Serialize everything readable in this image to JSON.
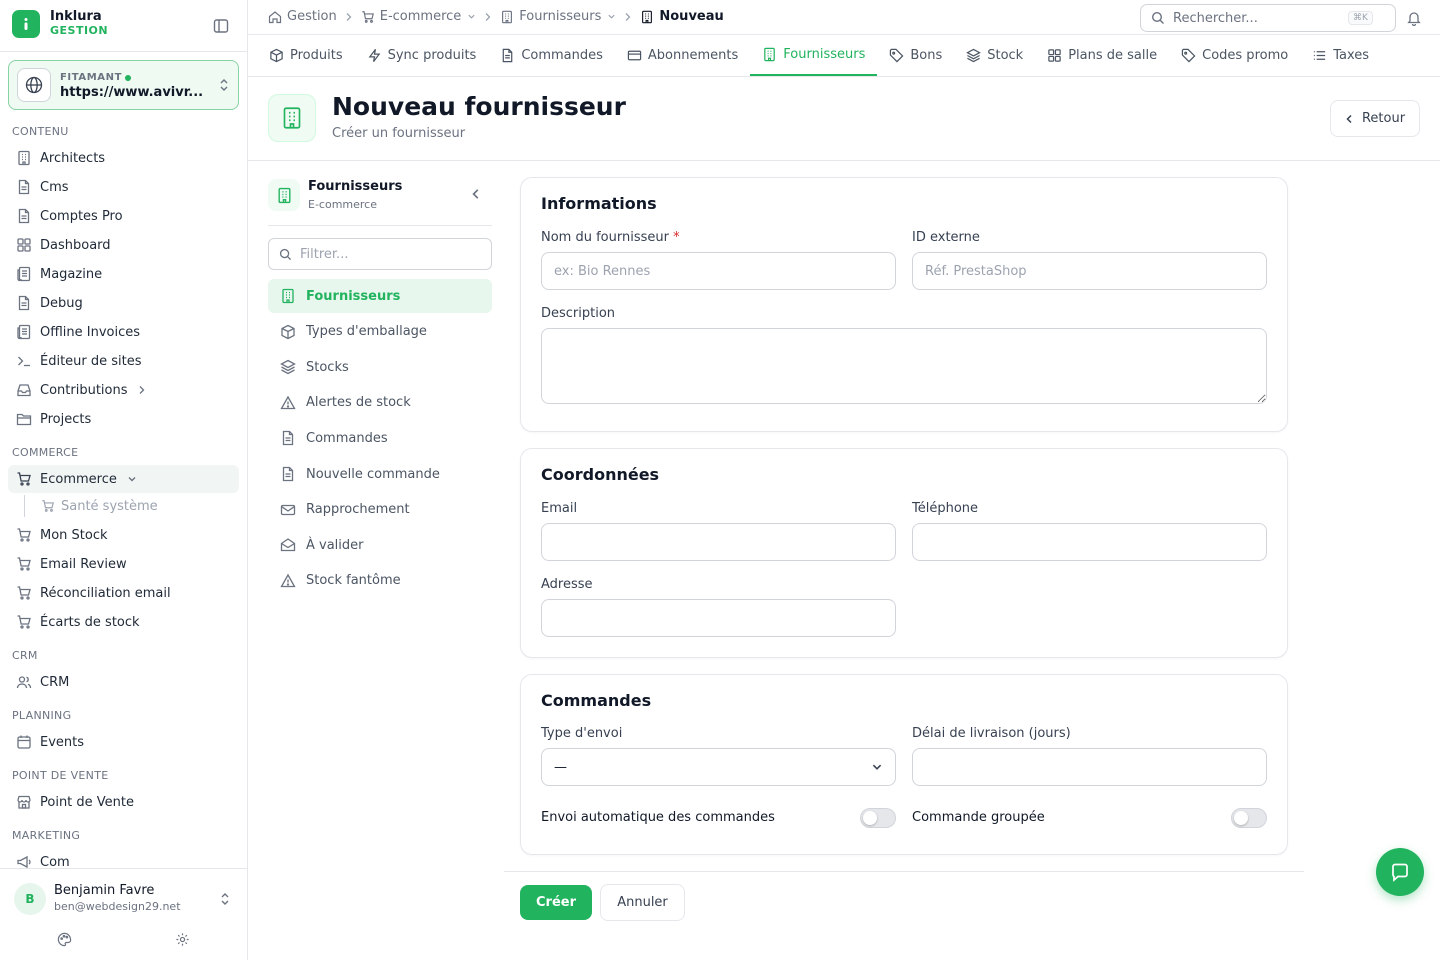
{
  "brand": {
    "name": "Inklura",
    "sub": "GESTION"
  },
  "site": {
    "label": "FITAMANT",
    "url": "https://www.avivr..."
  },
  "sidebar": {
    "sections": {
      "contenu": "CONTENU",
      "commerce": "COMMERCE",
      "crm": "CRM",
      "planning": "PLANNING",
      "pos": "POINT DE VENTE",
      "marketing": "MARKETING"
    },
    "contenu_items": [
      {
        "label": "Architects",
        "icon": "building-icon"
      },
      {
        "label": "Cms",
        "icon": "file-icon"
      },
      {
        "label": "Comptes Pro",
        "icon": "file-icon"
      },
      {
        "label": "Dashboard",
        "icon": "grid-icon"
      },
      {
        "label": "Magazine",
        "icon": "newspaper-icon"
      },
      {
        "label": "Debug",
        "icon": "file-icon"
      },
      {
        "label": "Offline Invoices",
        "icon": "newspaper-icon"
      },
      {
        "label": "Éditeur de sites",
        "icon": "terminal-icon"
      },
      {
        "label": "Contributions",
        "icon": "inbox-icon"
      },
      {
        "label": "Projects",
        "icon": "folder-icon"
      }
    ],
    "commerce_items": [
      {
        "label": "Ecommerce",
        "icon": "cart-icon"
      },
      {
        "label": "Santé système",
        "icon": "cart-icon"
      },
      {
        "label": "Mon Stock",
        "icon": "cart-icon"
      },
      {
        "label": "Email Review",
        "icon": "cart-icon"
      },
      {
        "label": "Réconciliation email",
        "icon": "cart-icon"
      },
      {
        "label": "Écarts de stock",
        "icon": "cart-icon"
      }
    ],
    "crm_item": "CRM",
    "planning_item": "Events",
    "pos_item": "Point de Vente",
    "marketing_item": "Com"
  },
  "user": {
    "initial": "B",
    "name": "Benjamin Favre",
    "email": "ben@webdesign29.net"
  },
  "breadcrumb": {
    "home": "Gestion",
    "ecommerce": "E-commerce",
    "fournisseurs": "Fournisseurs",
    "current": "Nouveau"
  },
  "search": {
    "placeholder": "Rechercher...",
    "shortcut": "⌘K"
  },
  "tabs": [
    {
      "label": "Produits",
      "icon": "box-icon"
    },
    {
      "label": "Sync produits",
      "icon": "bolt-icon"
    },
    {
      "label": "Commandes",
      "icon": "file-icon"
    },
    {
      "label": "Abonnements",
      "icon": "card-icon"
    },
    {
      "label": "Fournisseurs",
      "icon": "building-icon",
      "active": true
    },
    {
      "label": "Bons",
      "icon": "tag-icon"
    },
    {
      "label": "Stock",
      "icon": "layers-icon"
    },
    {
      "label": "Plans de salle",
      "icon": "grid-icon"
    },
    {
      "label": "Codes promo",
      "icon": "tag-icon"
    },
    {
      "label": "Taxes",
      "icon": "list-icon"
    }
  ],
  "page": {
    "title": "Nouveau fournisseur",
    "subtitle": "Créer un fournisseur",
    "back_label": "Retour"
  },
  "subnav": {
    "title": "Fournisseurs",
    "subtitle": "E-commerce",
    "filter_placeholder": "Filtrer...",
    "items": [
      {
        "label": "Fournisseurs",
        "icon": "building-icon",
        "active": true
      },
      {
        "label": "Types d'emballage",
        "icon": "box-icon"
      },
      {
        "label": "Stocks",
        "icon": "layers-icon"
      },
      {
        "label": "Alertes de stock",
        "icon": "alert-icon"
      },
      {
        "label": "Commandes",
        "icon": "file-icon"
      },
      {
        "label": "Nouvelle commande",
        "icon": "file-icon"
      },
      {
        "label": "Rapprochement",
        "icon": "mail-icon"
      },
      {
        "label": "À valider",
        "icon": "mail-open-icon"
      },
      {
        "label": "Stock fantôme",
        "icon": "alert-icon"
      }
    ]
  },
  "form": {
    "informations": {
      "title": "Informations",
      "name_label": "Nom du fournisseur",
      "required_mark": "*",
      "name_placeholder": "ex: Bio Rennes",
      "extid_label": "ID externe",
      "extid_placeholder": "Réf. PrestaShop",
      "description_label": "Description",
      "description_value": ""
    },
    "coordonnees": {
      "title": "Coordonnées",
      "email_label": "Email",
      "phone_label": "Téléphone",
      "address_label": "Adresse"
    },
    "commandes": {
      "title": "Commandes",
      "shipping_label": "Type d'envoi",
      "shipping_value": "—",
      "delay_label": "Délai de livraison (jours)",
      "auto_label": "Envoi automatique des commandes",
      "auto_on": false,
      "grouped_label": "Commande groupée",
      "grouped_on": false
    }
  },
  "actions": {
    "create": "Créer",
    "cancel": "Annuler"
  },
  "colors": {
    "accent": "#22b35e",
    "border": "#e5e7eb",
    "muted": "#6b7280"
  }
}
